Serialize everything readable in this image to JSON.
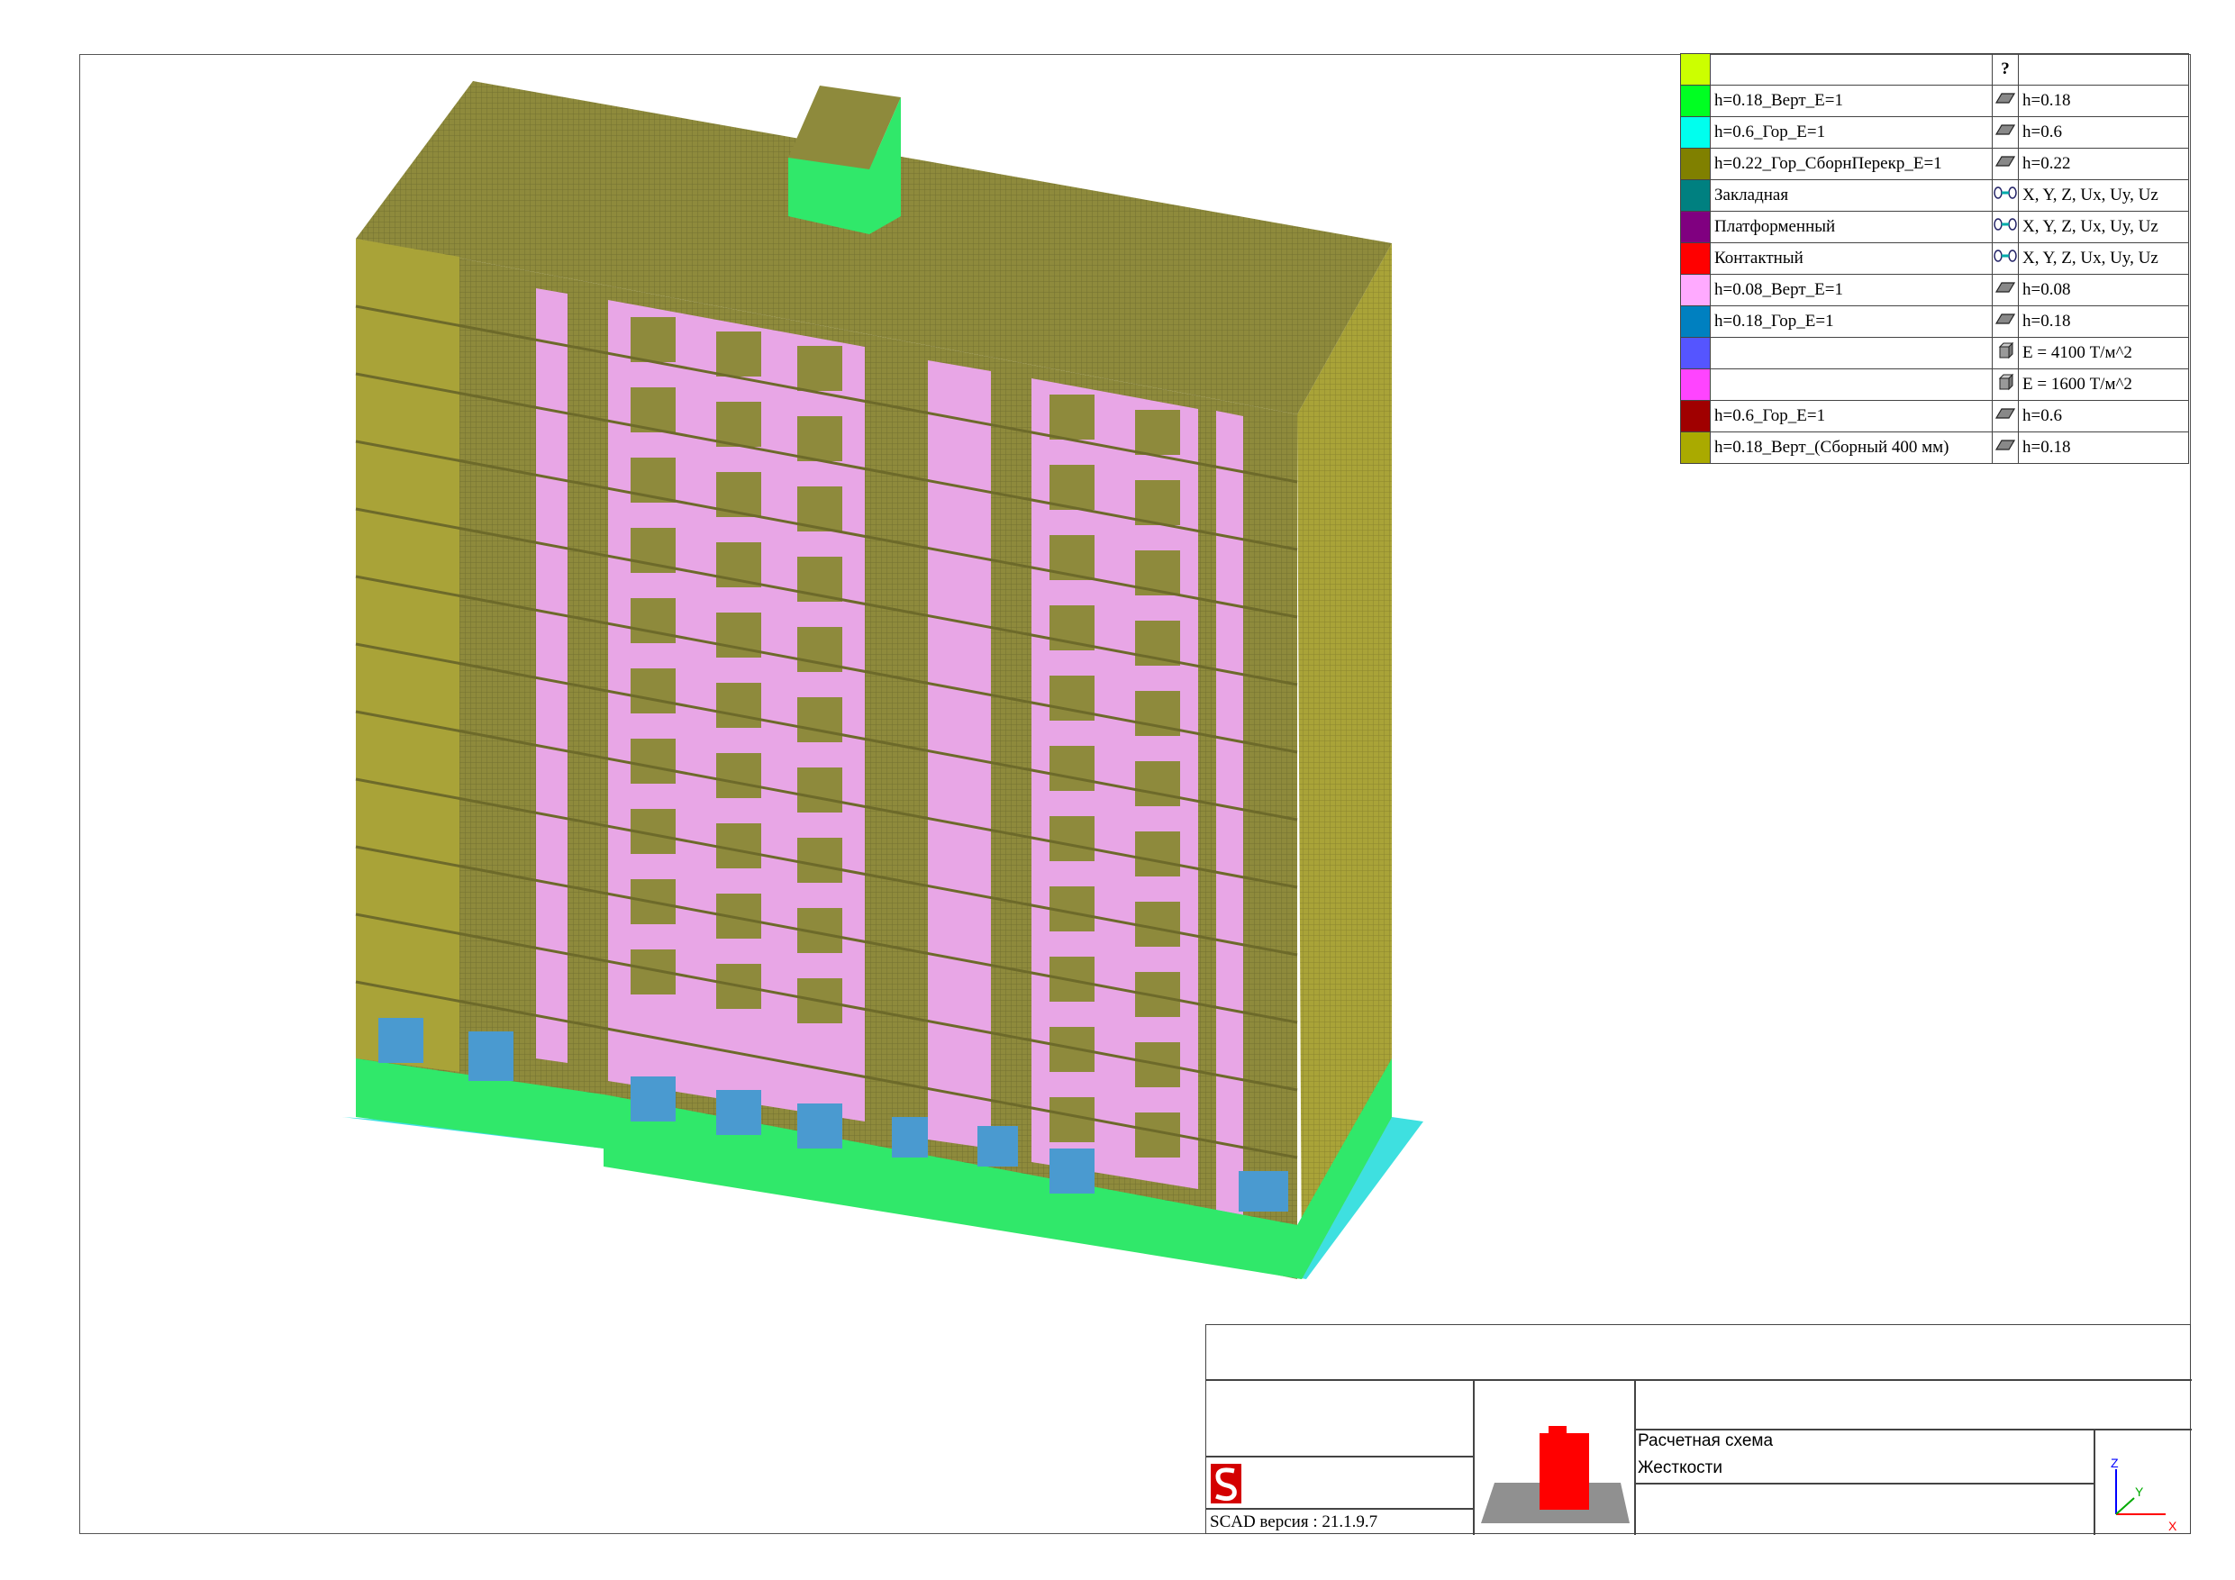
{
  "legend": {
    "header": {
      "value": "?"
    },
    "rows": [
      {
        "color": "#ccff00",
        "name": "",
        "icon": "",
        "value": ""
      },
      {
        "color": "#00ff22",
        "name": "h=0.18_Верт_E=1",
        "icon": "plate-icon",
        "value": "h=0.18"
      },
      {
        "color": "#00ffee",
        "name": "h=0.6_Гор_E=1",
        "icon": "plate-icon",
        "value": "h=0.6"
      },
      {
        "color": "#808000",
        "name": "h=0.22_Гор_СборнПерекр_E=1",
        "icon": "plate-icon",
        "value": "h=0.22"
      },
      {
        "color": "#008080",
        "name": "Закладная",
        "icon": "link-icon",
        "value": "X, Y, Z, Ux, Uy, Uz"
      },
      {
        "color": "#800080",
        "name": "Платформенный",
        "icon": "link-icon",
        "value": "X, Y, Z, Ux, Uy, Uz"
      },
      {
        "color": "#ff0000",
        "name": "Контактный",
        "icon": "link-icon",
        "value": "X, Y, Z, Ux, Uy, Uz"
      },
      {
        "color": "#ffaaff",
        "name": "h=0.08_Верт_E=1",
        "icon": "plate-icon",
        "value": "h=0.08"
      },
      {
        "color": "#0080c0",
        "name": "h=0.18_Гор_E=1",
        "icon": "plate-icon",
        "value": "h=0.18"
      },
      {
        "color": "#5555ff",
        "name": "",
        "icon": "solid-icon",
        "value": "E = 4100 Т/м^2"
      },
      {
        "color": "#ff44ff",
        "name": "",
        "icon": "solid-icon",
        "value": "E = 1600 Т/м^2"
      },
      {
        "color": "#a00000",
        "name": "h=0.6_Гор_E=1",
        "icon": "plate-icon",
        "value": "h=0.6"
      },
      {
        "color": "#aaaa00",
        "name": "h=0.18_Верт_(Сборный 400 мм)",
        "icon": "plate-icon",
        "value": "h=0.18"
      }
    ]
  },
  "title_block": {
    "version": "SCAD версия : 21.1.9.7",
    "scheme_title": "Расчетная схема",
    "scheme_subtitle": "Жесткости",
    "axes": {
      "x": "X",
      "y": "Y",
      "z": "Z"
    }
  },
  "colors": {
    "roof": "#8e8a3c",
    "wall_olive": "#a9a338",
    "pink": "#e8a6e6",
    "green": "#30e86a",
    "cyan": "#3ee0e0",
    "blue": "#4a9ad0",
    "thumb_red": "#ff0000",
    "thumb_grey": "#909090"
  }
}
